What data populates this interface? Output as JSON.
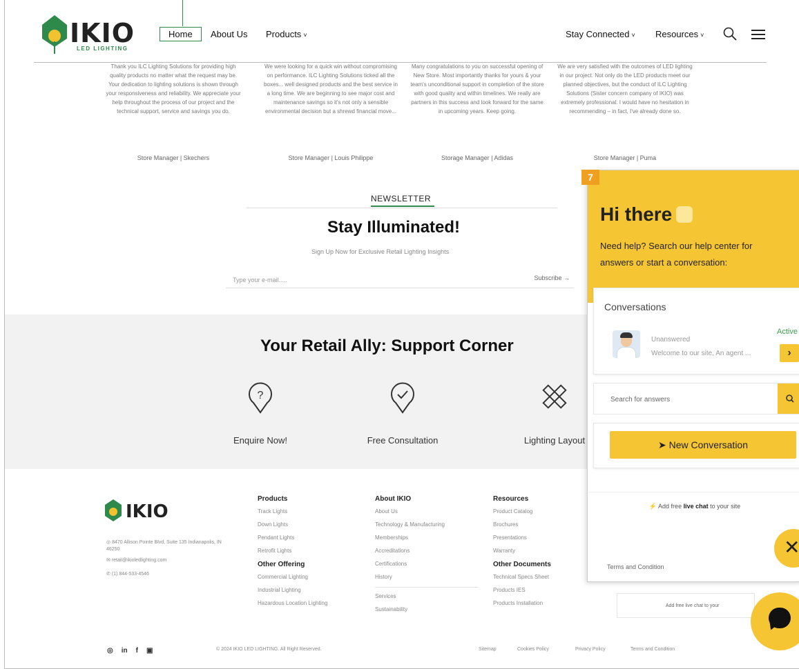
{
  "header": {
    "logo_text": "IKIO",
    "logo_sub": "LED LIGHTING",
    "nav": {
      "home": "Home",
      "about": "About Us",
      "products": "Products",
      "stay_connected": "Stay Connected",
      "resources": "Resources"
    },
    "search_icon": "search-icon",
    "menu_icon": "hamburger-menu-icon"
  },
  "testimonials": [
    {
      "text": "Thank you ILC Lighting Solutions for providing high quality products no matter what the request may be. Your dedication to lighting solutions is shown through your responsiveness and reliability. We appreciate your help throughout the process of our project and the technical support, service and savings you do.",
      "author": "Store Manager | Skechers"
    },
    {
      "text": "We were looking for a quick win without compromising on performance. ILC Lighting Solutions ticked all the boxes... well designed products and the best service in a long time. We are beginning to see major cost and maintenance savings so it's not only a sensible environmental decision but a shrewd financial move...",
      "author": "Store Manager | Louis Philippe"
    },
    {
      "text": "Many congratulations to you on successful opening of New Store. Most importantly thanks for yours & your team's unconditional support in completion of the store with good quality and within timelines. We really are partners in this success and look forward for the same in upcoming years. Keep going.",
      "author": "Storage Manager | Adidas"
    },
    {
      "text": "We are very satisfied with the outcomes of LED lighting in our project. Not only do the LED products meet our planned objectives, but the conduct of ILC Lighting Solutions (Sister concern company of IKIO) was extremely professional. I would have no hesitation in recommending – in fact, I've already done so.",
      "author": "Store Manager | Puma"
    }
  ],
  "newsletter": {
    "label": "NEWSLETTER",
    "title": "Stay Illuminated!",
    "subtitle": "Sign Up Now for Exclusive Retail Lighting Insights",
    "placeholder": "Type your e-mail.....",
    "subscribe": "Subscribe"
  },
  "support": {
    "title": "Your Retail Ally: Support Corner",
    "items": [
      {
        "label": "Enquire Now!",
        "icon": "question-pin-icon"
      },
      {
        "label": "Free Consultation",
        "icon": "check-pin-icon"
      },
      {
        "label": "Lighting Layout",
        "icon": "ruler-pencil-icon"
      }
    ]
  },
  "footer": {
    "contact": {
      "address": "8470 Allison Pointe Blvd, Suite 135 Indianapolis, IN 46250",
      "email": "retail@ikioledlighting.com",
      "phone": "(1) 844-533-4546"
    },
    "products": {
      "title": "Products",
      "items": [
        "Track Lights",
        "Down Lights",
        "Pendant Lights",
        "Retrofit Lights"
      ]
    },
    "other_offering": {
      "title": "Other Offering",
      "items": [
        "Commercial Lighting",
        "Industrial Lighting",
        "Hazardous Location Lighting"
      ]
    },
    "about": {
      "title": "About IKIO",
      "items": [
        "About Us",
        "Technology & Manufacturing",
        "Memberships",
        "Accreditations",
        "Certifications",
        "History",
        "Services",
        "Sustainability"
      ]
    },
    "resources": {
      "title": "Resources",
      "items": [
        "Product Catalog",
        "Brochures",
        "Presentations",
        "Warranty"
      ]
    },
    "other_documents": {
      "title": "Other Documents",
      "items": [
        "Technical Specs Sheet",
        "Products IES",
        "Products Installation"
      ]
    },
    "copyright": "© 2024 IKIO LED LIGHTING. All Right Reserved.",
    "links": [
      "Sitemap",
      "Cookies Policy",
      "Privacy Policy",
      "Terms and Condition"
    ],
    "social": [
      "whatsapp-icon",
      "linkedin-icon",
      "facebook-icon",
      "youtube-icon"
    ],
    "livechat_small": "Add free live chat to your"
  },
  "chat": {
    "marker": "7",
    "greeting": "Hi there",
    "help": "Need help? Search our help center for answers or start a conversation:",
    "conversations_title": "Conversations",
    "status": "Unanswered",
    "preview": "Welcome to our site, An agent ...",
    "active": "Active",
    "search_placeholder": "Search for answers",
    "new_conversation": "New Conversation",
    "livechat_prefix": "Add free",
    "livechat_bold": "live chat",
    "livechat_suffix": "to your site",
    "terms": "Terms and Condition",
    "accent": "#f6c534"
  }
}
